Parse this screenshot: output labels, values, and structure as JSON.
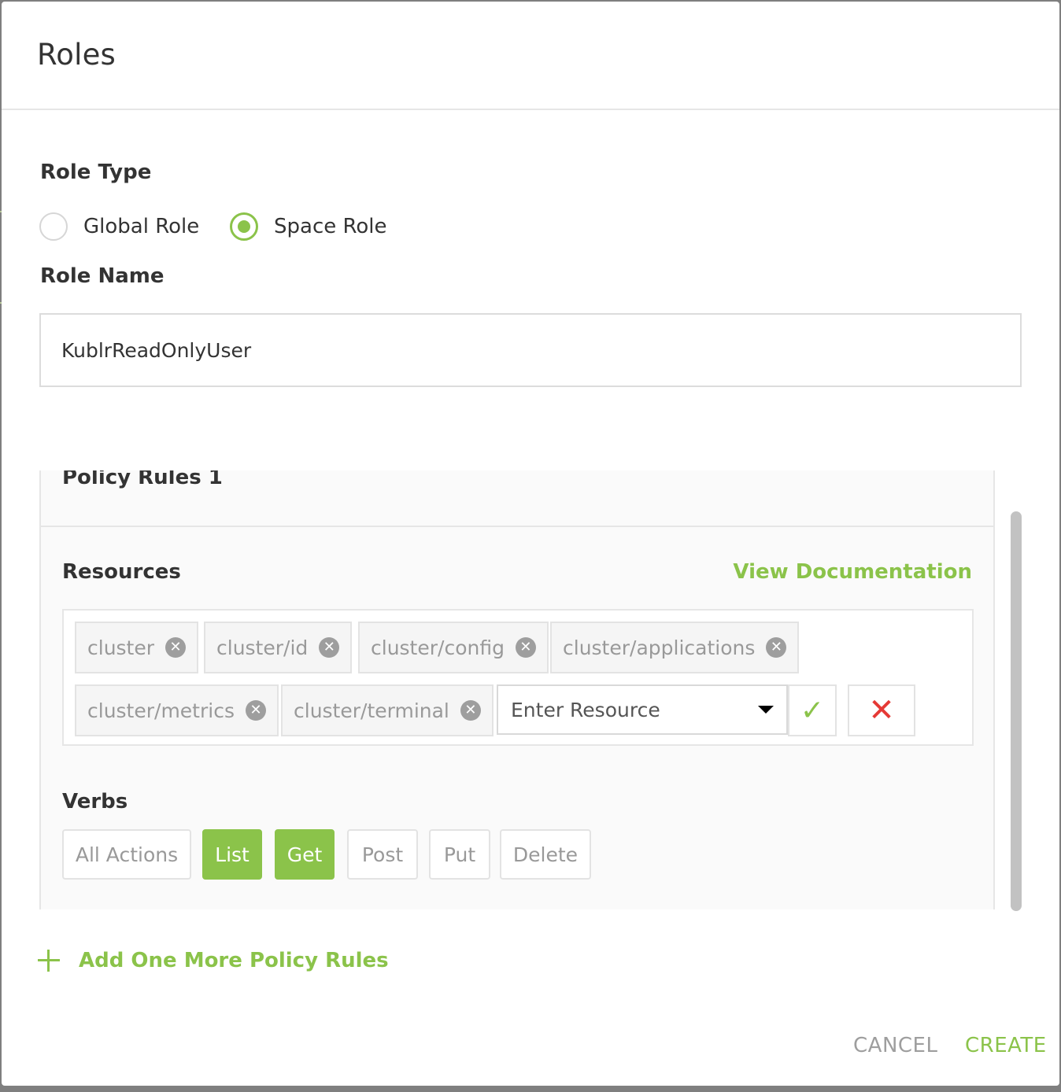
{
  "dialog": {
    "title": "Roles"
  },
  "role_type": {
    "label": "Role Type",
    "options": [
      {
        "label": "Global Role",
        "selected": false
      },
      {
        "label": "Space Role",
        "selected": true
      }
    ]
  },
  "role_name": {
    "label": "Role Name",
    "value": "KublrReadOnlyUser"
  },
  "policy_rules": {
    "title": "Policy Rules 1",
    "resources_label": "Resources",
    "view_documentation": "View Documentation",
    "resources": [
      "cluster",
      "cluster/id",
      "cluster/config",
      "cluster/applications",
      "cluster/metrics",
      "cluster/terminal"
    ],
    "remove_glyph": "✕",
    "resource_input_placeholder": "Enter Resource",
    "confirm_icon": "checkmark-icon",
    "cancel_icon": "close-icon",
    "verbs_label": "Verbs",
    "verbs": [
      {
        "label": "All Actions",
        "active": false
      },
      {
        "label": "List",
        "active": true
      },
      {
        "label": "Get",
        "active": true
      },
      {
        "label": "Post",
        "active": false
      },
      {
        "label": "Put",
        "active": false
      },
      {
        "label": "Delete",
        "active": false
      }
    ]
  },
  "add_rule": {
    "label": "Add One More Policy Rules"
  },
  "footer": {
    "cancel": "CANCEL",
    "create": "CREATE"
  },
  "colors": {
    "accent": "#8bc34a",
    "danger": "#e53935",
    "backdrop": "#7f7f7f"
  }
}
